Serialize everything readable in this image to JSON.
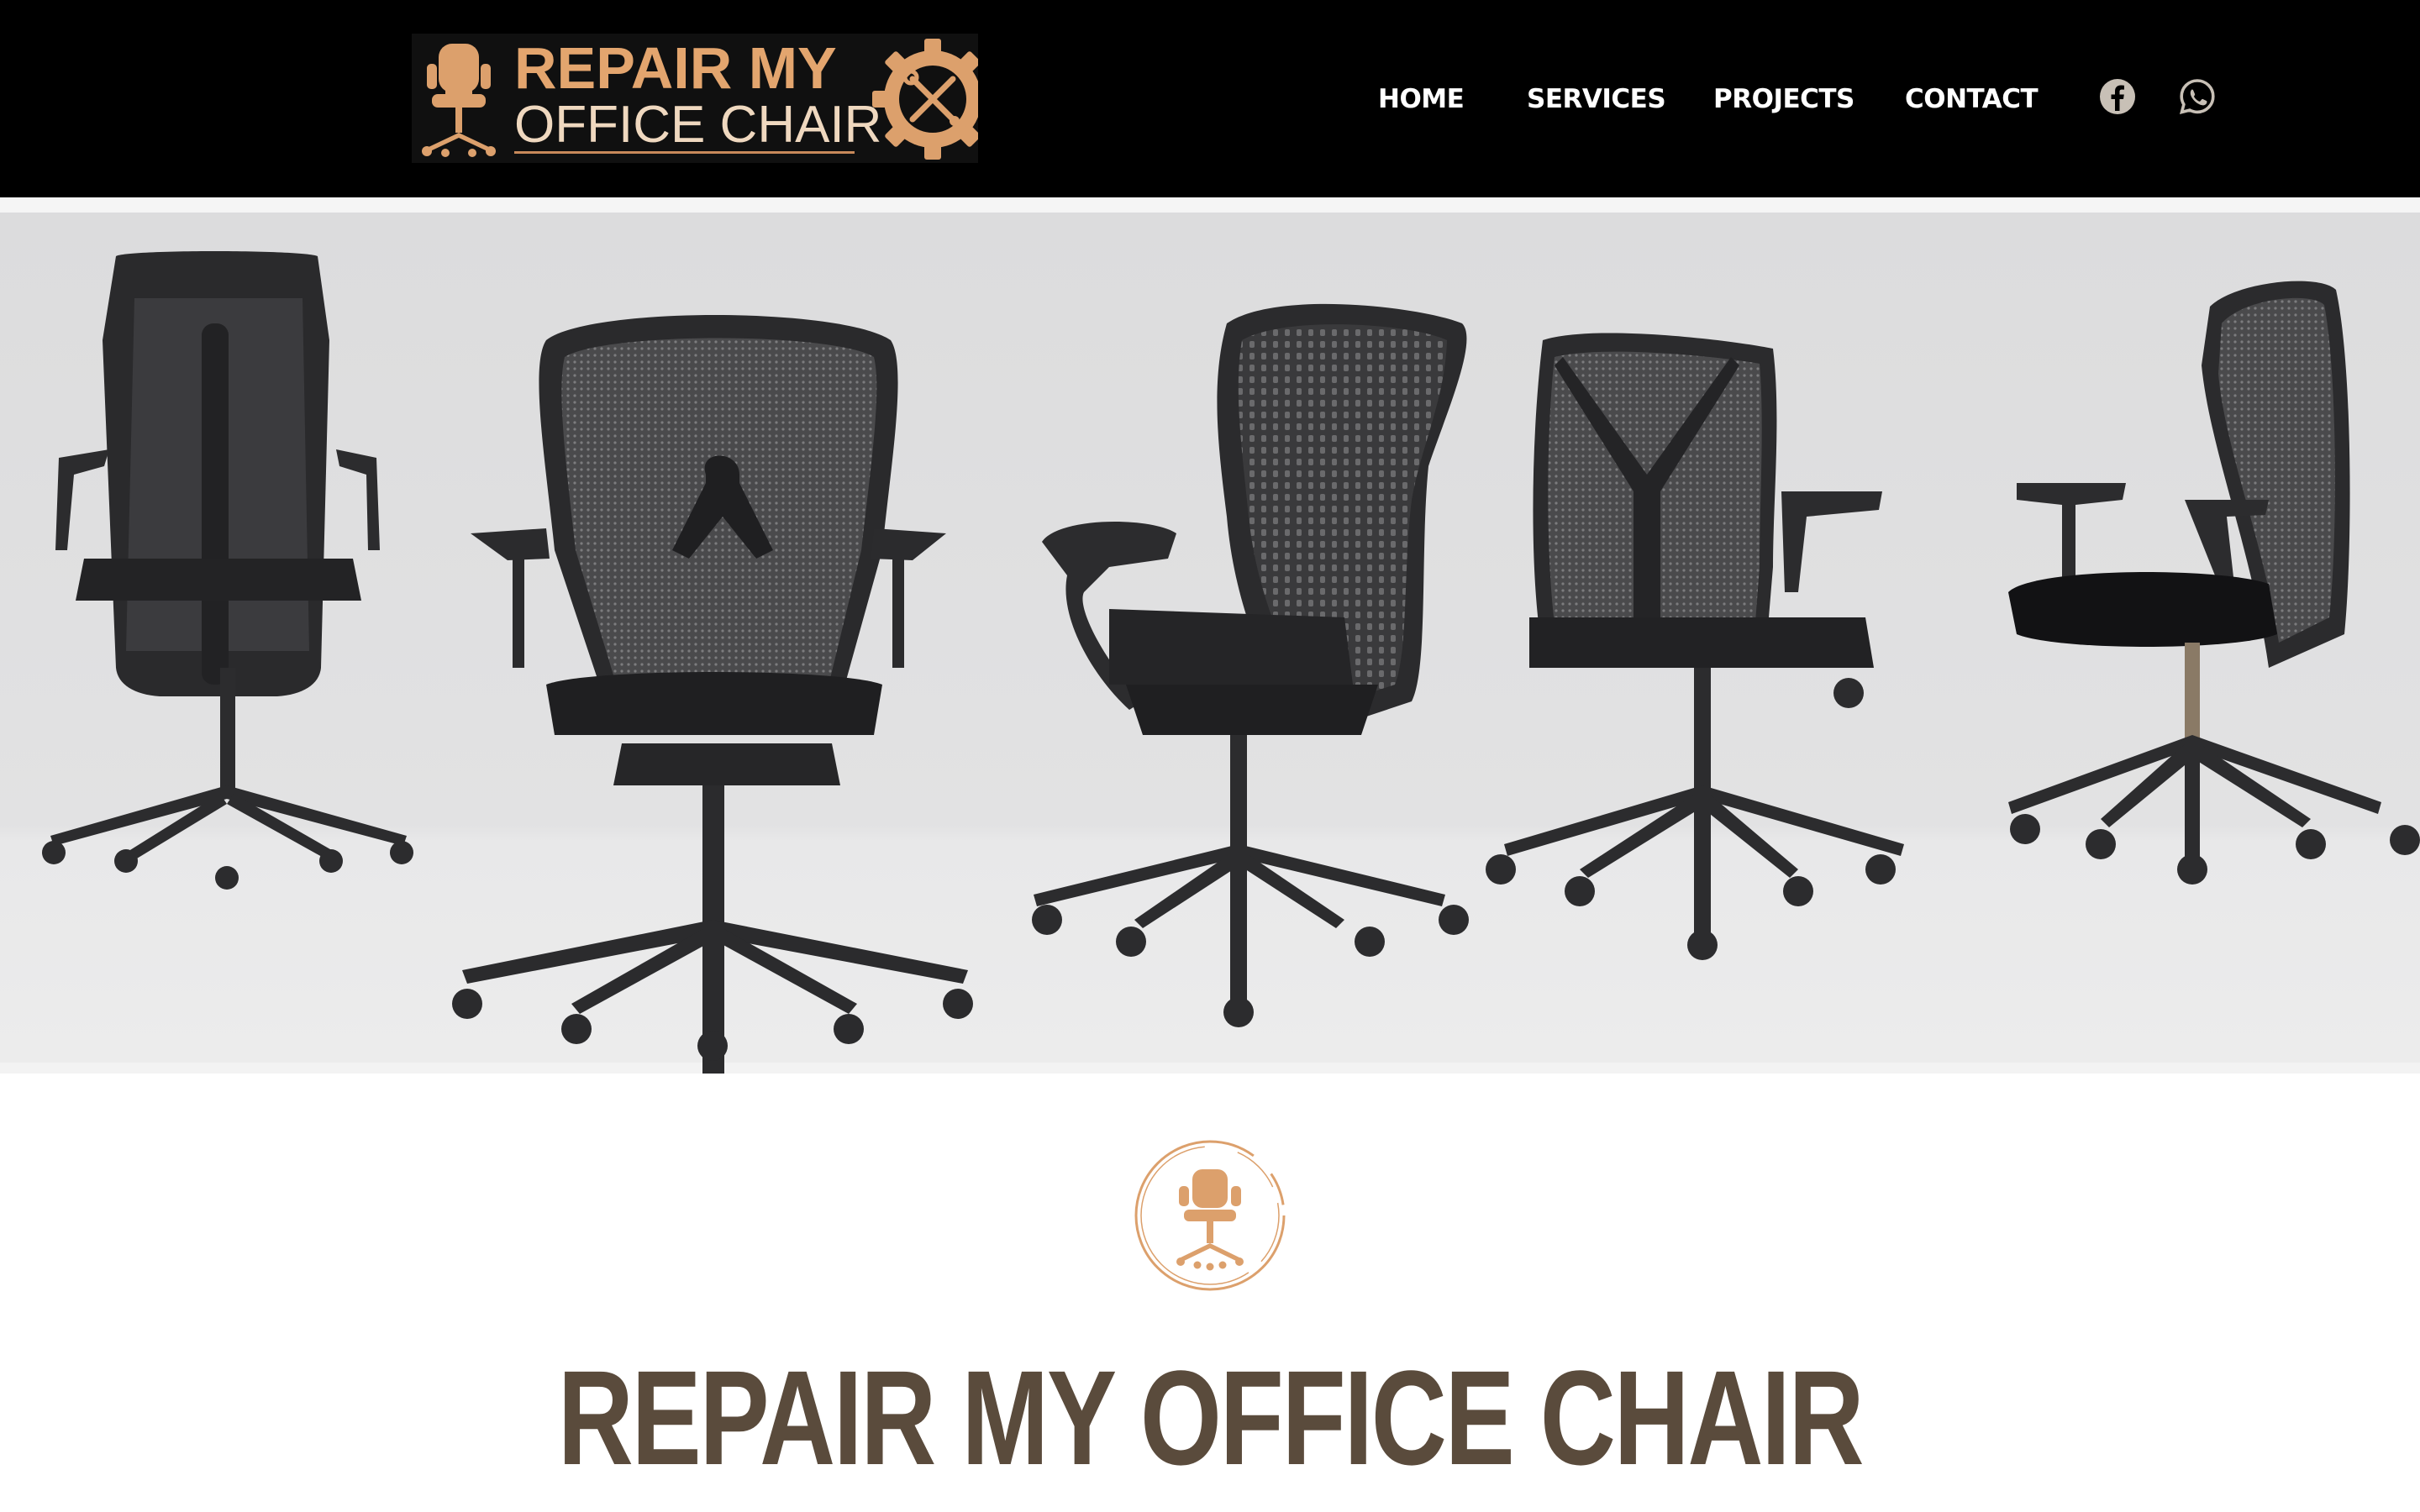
{
  "header": {
    "logo": {
      "line1": "REPAIR MY",
      "line2": "OFFICE CHAIR",
      "icon": "chair-gear-wrench-logo"
    },
    "nav": {
      "items": [
        {
          "label": "HOME"
        },
        {
          "label": "SERVICES"
        },
        {
          "label": "PROJECTS"
        },
        {
          "label": "CONTACT"
        }
      ]
    },
    "social": [
      {
        "icon": "facebook-icon"
      },
      {
        "icon": "whatsapp-icon"
      }
    ]
  },
  "hero": {
    "image": "office-chairs-lineup-photo"
  },
  "main": {
    "badge_icon": "chair-circle-icon",
    "title": "REPAIR MY OFFICE CHAIR"
  },
  "colors": {
    "header_bg": "#000000",
    "accent_copper": "#d89a63",
    "title_brown": "#5a4b3c",
    "hero_bg": "#ececec"
  }
}
